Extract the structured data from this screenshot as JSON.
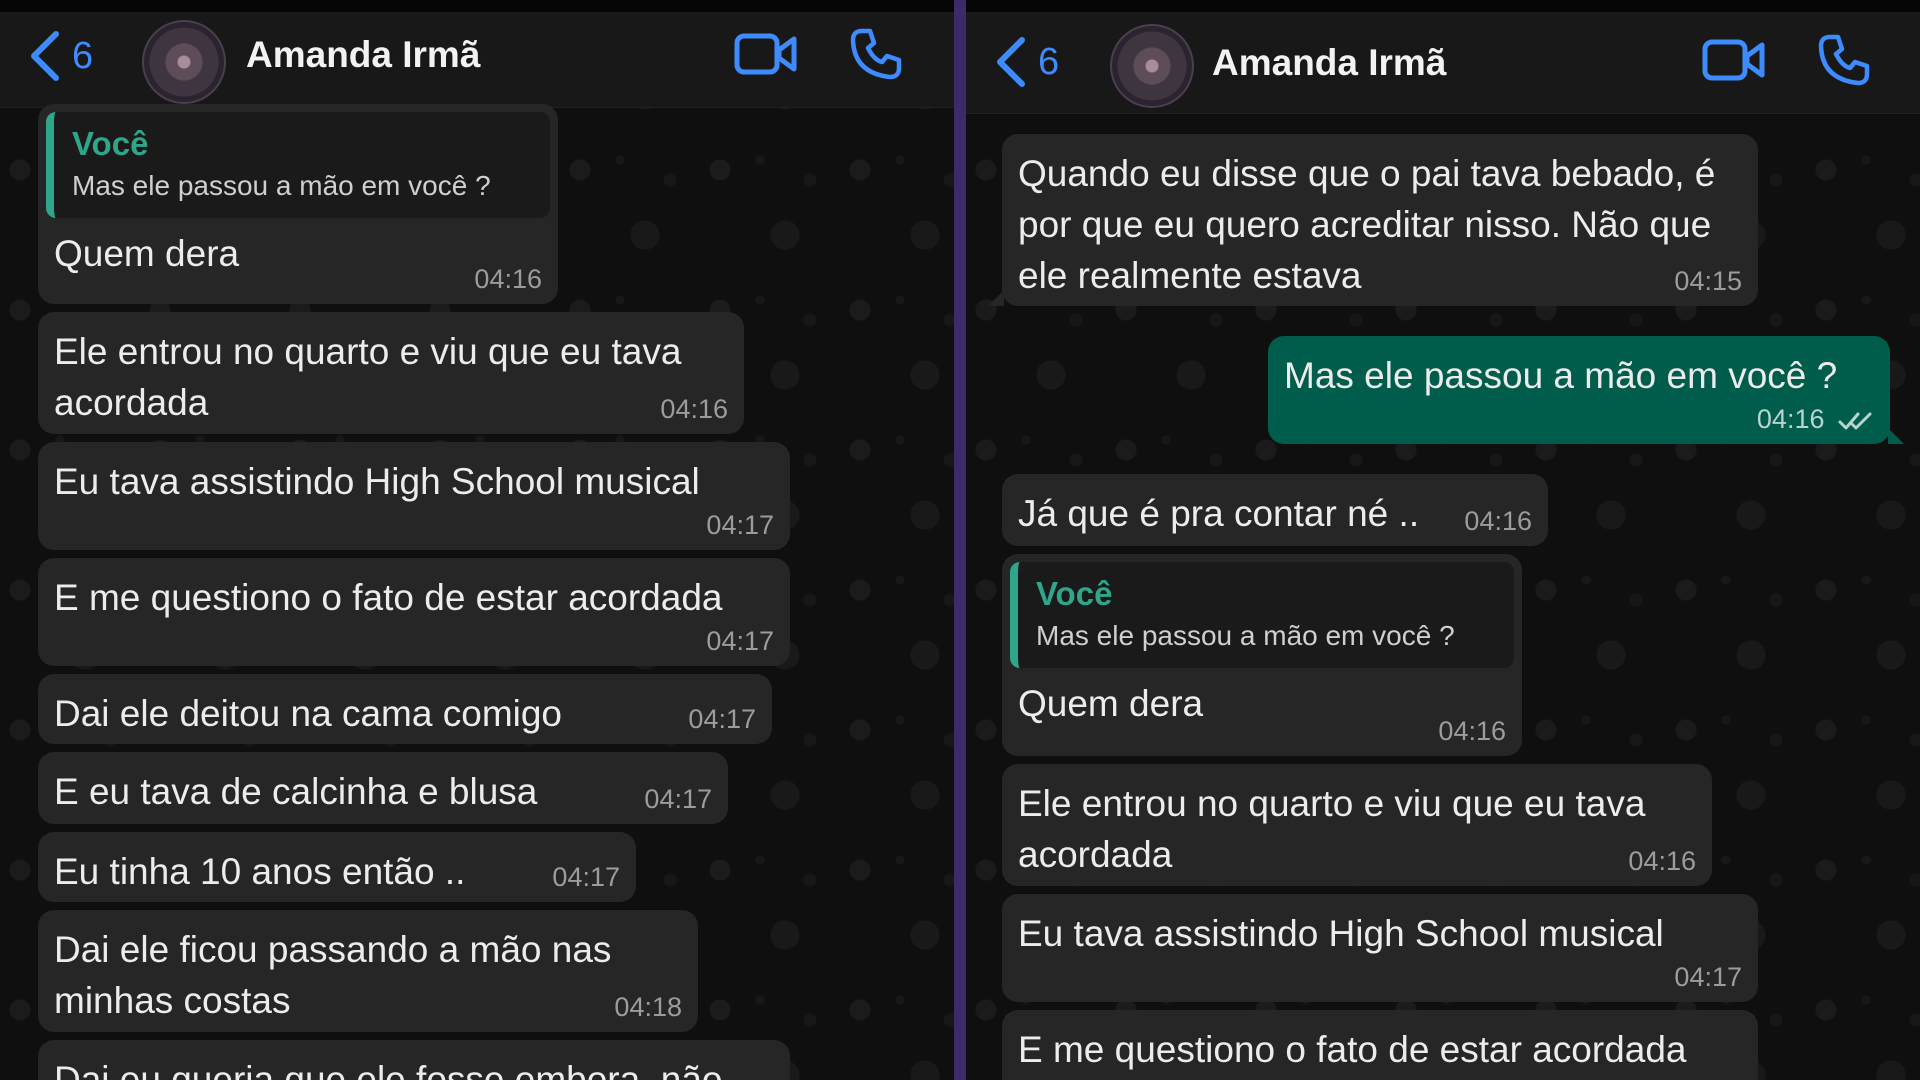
{
  "left": {
    "header": {
      "back_count": "6",
      "contact_name": "Amanda Irmã"
    },
    "messages": [
      {
        "quote_author": "Você",
        "quote_text": "Mas ele passou a mão em você ?",
        "text": "Quem dera",
        "time": "04:16"
      },
      {
        "text": "Ele entrou no quarto e viu que eu tava acordada",
        "time": "04:16"
      },
      {
        "text": "Eu tava assistindo High School musical",
        "time": "04:17"
      },
      {
        "text": "E me questiono o fato de estar acordada",
        "time": "04:17"
      },
      {
        "text": "Dai ele deitou na cama comigo",
        "time": "04:17"
      },
      {
        "text": "E eu tava de calcinha e blusa",
        "time": "04:17"
      },
      {
        "text": "Eu tinha 10 anos então ..",
        "time": "04:17"
      },
      {
        "text": "Dai ele ficou passando a mão nas minhas costas",
        "time": "04:18"
      },
      {
        "text": "Dai eu queria que ele fosse embora, não",
        "time": ""
      }
    ]
  },
  "right": {
    "header": {
      "back_count": "6",
      "contact_name": "Amanda Irmã"
    },
    "messages": [
      {
        "text": "Quando eu disse que o pai tava bebado, é por que eu quero acreditar nisso. Não que ele realmente estava",
        "time": "04:15"
      },
      {
        "text": "Mas ele passou a mão em você ?",
        "time": "04:16",
        "outgoing": true,
        "status": "read"
      },
      {
        "text": "Já que é pra contar né ..",
        "time": "04:16"
      },
      {
        "quote_author": "Você",
        "quote_text": "Mas ele passou a mão em você ?",
        "text": "Quem dera",
        "time": "04:16"
      },
      {
        "text": "Ele entrou no quarto e viu que eu tava acordada",
        "time": "04:16"
      },
      {
        "text": "Eu tava assistindo High School musical",
        "time": "04:17"
      },
      {
        "text": "E me questiono o fato de estar acordada",
        "time": ""
      }
    ]
  },
  "colors": {
    "accent": "#3d8bfd",
    "quote_accent": "#2fa58a",
    "incoming_bubble": "#262626",
    "outgoing_bubble": "#005c4b"
  }
}
